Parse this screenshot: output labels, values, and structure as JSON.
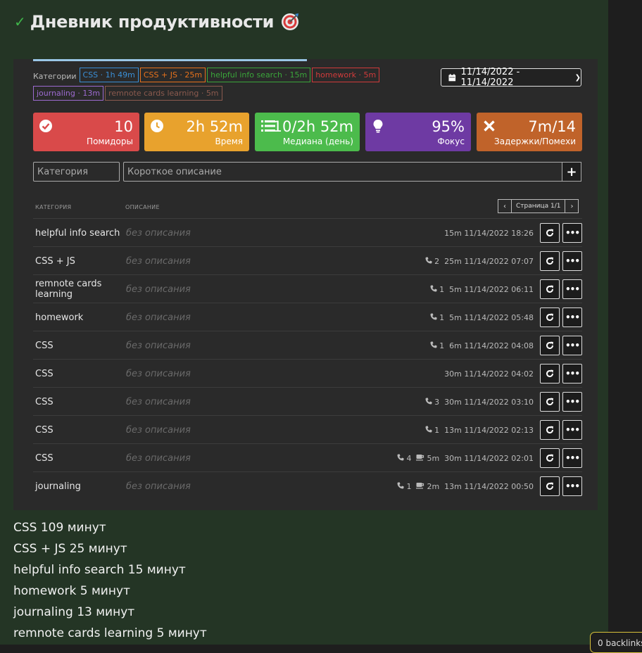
{
  "title": "Дневник продуктивности",
  "categories_label": "Категории",
  "category_tags": [
    {
      "text": "CSS · 1h 49m",
      "color": "#3a8fd6"
    },
    {
      "text": "CSS + JS · 25m",
      "color": "#e8721c"
    },
    {
      "text": "helpful info search · 15m",
      "color": "#3aa63a"
    },
    {
      "text": "homework · 5m",
      "color": "#d13b3b"
    },
    {
      "text": "journaling · 13m",
      "color": "#9d6bd1"
    },
    {
      "text": "remnote cards learning · 5m",
      "color": "#8b5a4e"
    }
  ],
  "date_range": "11/14/2022 - 11/14/2022",
  "stats": [
    {
      "icon": "check-circle-icon",
      "value": "10",
      "label": "Помидоры",
      "color": "#d94a4a"
    },
    {
      "icon": "clock-icon",
      "value": "2h 52m",
      "label": "Время",
      "color": "#e8a22d"
    },
    {
      "icon": "list-icon",
      "value": "10/2h 52m",
      "label": "Медиана (день)",
      "color": "#4cbb4c"
    },
    {
      "icon": "lightbulb-icon",
      "value": "95%",
      "label": "Фокус",
      "color": "#6e3aa3"
    },
    {
      "icon": "x-icon",
      "value": "7m/14",
      "label": "Задержки/Помехи",
      "color": "#c0632a"
    }
  ],
  "inputs": {
    "category_placeholder": "Категория",
    "description_placeholder": "Короткое описание"
  },
  "table": {
    "header_category": "КАТЕГОРИЯ",
    "header_description": "ОПИСАНИЕ",
    "pager_label": "Страница 1/1",
    "rows": [
      {
        "category": "helpful info search",
        "description": "без описания",
        "calls": "",
        "breaks": "",
        "duration": "15m",
        "time": "11/14/2022 18:26"
      },
      {
        "category": "CSS + JS",
        "description": "без описания",
        "calls": "2",
        "breaks": "",
        "duration": "25m",
        "time": "11/14/2022 07:07"
      },
      {
        "category": "remnote cards learning",
        "description": "без описания",
        "calls": "1",
        "breaks": "",
        "duration": "5m",
        "time": "11/14/2022 06:11"
      },
      {
        "category": "homework",
        "description": "без описания",
        "calls": "1",
        "breaks": "",
        "duration": "5m",
        "time": "11/14/2022 05:48"
      },
      {
        "category": "CSS",
        "description": "без описания",
        "calls": "1",
        "breaks": "",
        "duration": "6m",
        "time": "11/14/2022 04:08"
      },
      {
        "category": "CSS",
        "description": "без описания",
        "calls": "",
        "breaks": "",
        "duration": "30m",
        "time": "11/14/2022 04:02"
      },
      {
        "category": "CSS",
        "description": "без описания",
        "calls": "3",
        "breaks": "",
        "duration": "30m",
        "time": "11/14/2022 03:10"
      },
      {
        "category": "CSS",
        "description": "без описания",
        "calls": "1",
        "breaks": "",
        "duration": "13m",
        "time": "11/14/2022 02:13"
      },
      {
        "category": "CSS",
        "description": "без описания",
        "calls": "4",
        "breaks": "5m",
        "duration": "30m",
        "time": "11/14/2022 02:01"
      },
      {
        "category": "journaling",
        "description": "без описания",
        "calls": "1",
        "breaks": "2m",
        "duration": "13m",
        "time": "11/14/2022 00:50"
      }
    ]
  },
  "summary": [
    "CSS 109 минут",
    "CSS + JS 25 минут",
    "helpful info search 15 минут",
    "homework 5 минут",
    "journaling 13 минут",
    "remnote cards learning 5 минут"
  ],
  "backlinks": "0 backlinks"
}
